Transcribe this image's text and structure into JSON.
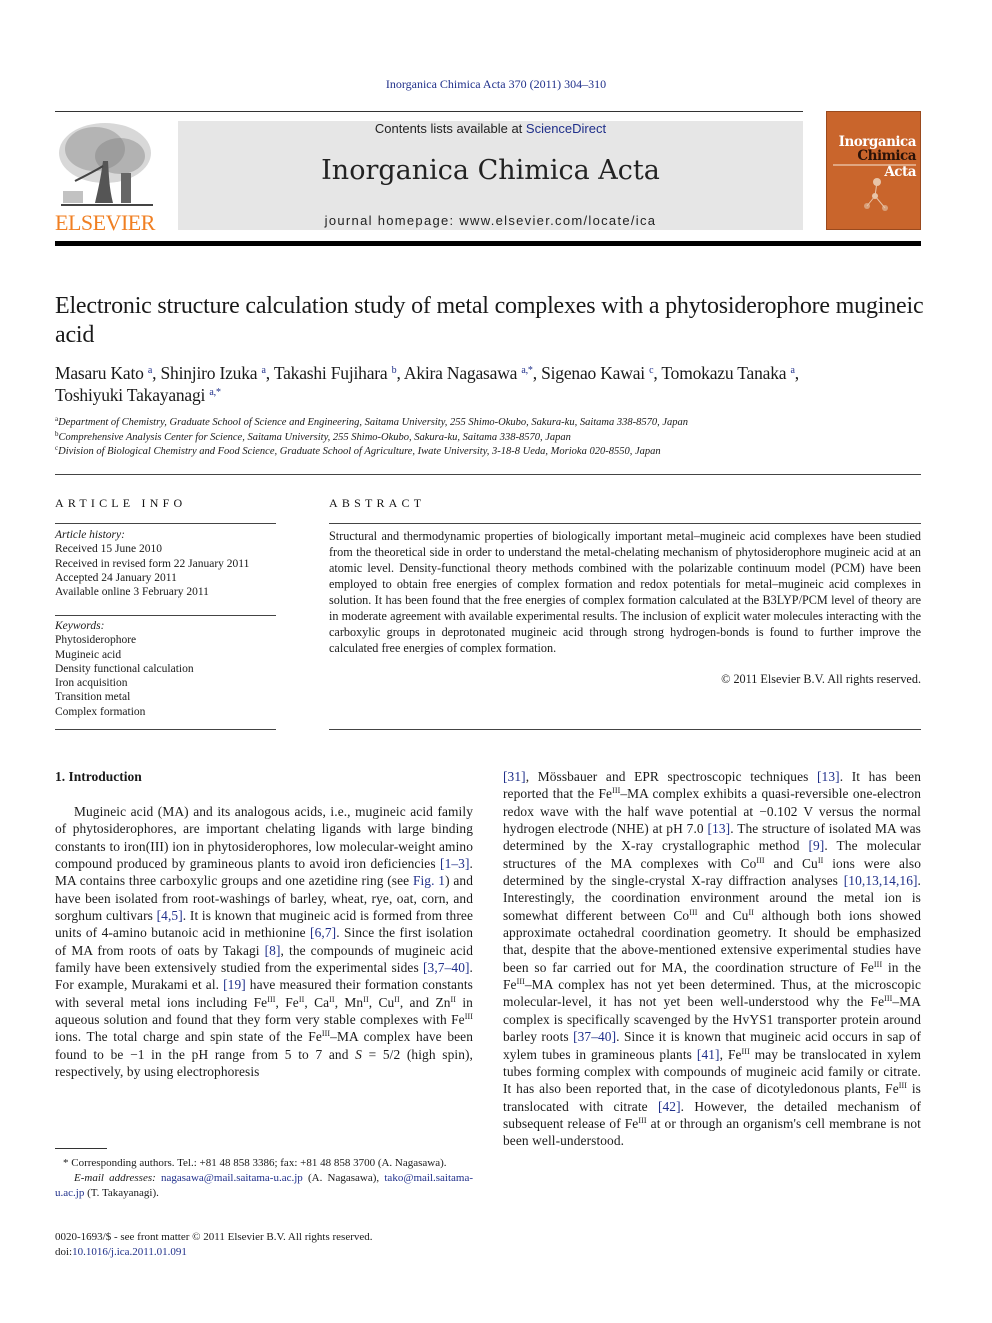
{
  "header": {
    "citation": "Inorganica Chimica Acta 370 (2011) 304–310",
    "contents_prefix": "Contents lists available at ",
    "contents_link": "ScienceDirect",
    "journal_name": "Inorganica Chimica Acta",
    "homepage": "journal homepage: www.elsevier.com/locate/ica",
    "publisher_logo_text": "ELSEVIER",
    "cover": {
      "line1": "Inorganica",
      "line2a": "Chimica",
      "line2b": "Acta",
      "background": "#c9652c"
    }
  },
  "article": {
    "title": "Electronic structure calculation study of metal complexes with a phytosiderophore mugineic acid",
    "authors": [
      {
        "name": "Masaru Kato",
        "aff": "a",
        "sep": ", "
      },
      {
        "name": "Shinjiro Izuka",
        "aff": "a",
        "sep": ", "
      },
      {
        "name": "Takashi Fujihara",
        "aff": "b",
        "sep": ", "
      },
      {
        "name": "Akira Nagasawa",
        "aff": "a,*",
        "sep": ", "
      },
      {
        "name": "Sigenao Kawai",
        "aff": "c",
        "sep": ", "
      },
      {
        "name": "Tomokazu Tanaka",
        "aff": "a",
        "sep": ","
      },
      {
        "name": "Toshiyuki Takayanagi",
        "aff": "a,*",
        "sep": ""
      }
    ],
    "affiliations": [
      {
        "key": "a",
        "text": "Department of Chemistry, Graduate School of Science and Engineering, Saitama University, 255 Shimo-Okubo, Sakura-ku, Saitama 338-8570, Japan"
      },
      {
        "key": "b",
        "text": "Comprehensive Analysis Center for Science, Saitama University, 255 Shimo-Okubo, Sakura-ku, Saitama 338-8570, Japan"
      },
      {
        "key": "c",
        "text": "Division of Biological Chemistry and Food Science, Graduate School of Agriculture, Iwate University, 3-18-8 Ueda, Morioka 020-8550, Japan"
      }
    ]
  },
  "article_info": {
    "heading": "ARTICLE INFO",
    "history_label": "Article history:",
    "history": [
      "Received 15 June 2010",
      "Received in revised form 22 January 2011",
      "Accepted 24 January 2011",
      "Available online 3 February 2011"
    ],
    "keywords_label": "Keywords:",
    "keywords": [
      "Phytosiderophore",
      "Mugineic acid",
      "Density functional calculation",
      "Iron acquisition",
      "Transition metal",
      "Complex formation"
    ]
  },
  "abstract": {
    "heading": "ABSTRACT",
    "text": "Structural and thermodynamic properties of biologically important metal–mugineic acid complexes have been studied from the theoretical side in order to understand the metal-chelating mechanism of phytos­iderophore mugineic acid at an atomic level. Density-functional theory methods combined with the polarizable continuum model (PCM) have been employed to obtain free energies of complex formation and redox potentials for metal–mugineic acid complexes in solution. It has been found that the free ener­gies of complex formation calculated at the B3LYP/PCM level of theory are in moderate agreement with available experimental results. The inclusion of explicit water molecules interacting with the carboxylic groups in deprotonated mugineic acid through strong hydrogen-bonds is found to further improve the calculated free energies of complex formation.",
    "copyright": "© 2011 Elsevier B.V. All rights reserved."
  },
  "intro": {
    "heading": "1. Introduction",
    "left": [
      {
        "t": "Mugineic acid (MA) and its analogous acids, i.e., mugineic acid family of phytosiderophores, are important chelating ligands with large binding constants to iron(III) ion in phytosiderophores, low molecular-weight amino compound produced by gramineous plants to avoid iron deficiencies "
      },
      {
        "link": "[1–3]"
      },
      {
        "t": ". MA contains three carbox­ylic groups and one azetidine ring (see "
      },
      {
        "link": "Fig. 1"
      },
      {
        "t": ") and have been iso­lated from root-washings of barley, wheat, rye, oat, corn, and sorghum cultivars "
      },
      {
        "link": "[4,5]"
      },
      {
        "t": ". It is known that mugineic acid is formed from three units of 4-amino butanoic acid in methionine "
      },
      {
        "link": "[6,7]"
      },
      {
        "t": ". Since the first isolation of MA from roots of oats by Takagi "
      },
      {
        "link": "[8]"
      },
      {
        "t": ", the compounds of mugineic acid family have been extensively studied from the experimental sides "
      },
      {
        "link": "[3,7–40]"
      },
      {
        "t": ". For example, Mura­kami et al. "
      },
      {
        "link": "[19]"
      },
      {
        "t": " have measured their formation constants with several metal ions including Fe"
      },
      {
        "sup": "III"
      },
      {
        "t": ", Fe"
      },
      {
        "sup": "II"
      },
      {
        "t": ", Ca"
      },
      {
        "sup": "II"
      },
      {
        "t": ", Mn"
      },
      {
        "sup": "II"
      },
      {
        "t": ", Cu"
      },
      {
        "sup": "II"
      },
      {
        "t": ", and Zn"
      },
      {
        "sup": "II"
      },
      {
        "t": " in aqueous solution and found that they form very stable complexes with Fe"
      },
      {
        "sup": "III"
      },
      {
        "t": " ions. The total charge and spin state of the Fe"
      },
      {
        "sup": "III"
      },
      {
        "t": "–MA complex have been found to be −1 in the pH range from 5 to 7 and "
      },
      {
        "i": "S"
      },
      {
        "t": " = 5/2 (high spin), respectively, by using electrophoresis"
      }
    ],
    "right": [
      {
        "link": "[31]"
      },
      {
        "t": ", Mössbauer and EPR spectroscopic techniques "
      },
      {
        "link": "[13]"
      },
      {
        "t": ". It has been reported that the Fe"
      },
      {
        "sup": "III"
      },
      {
        "t": "–MA complex exhibits a quasi-revers­ible one-electron redox wave with the half wave potential at −0.102 V versus the normal hydrogen electrode (NHE) at pH 7.0 "
      },
      {
        "link": "[13]"
      },
      {
        "t": ". The structure of isolated MA was determined by the X-ray crystallographic method "
      },
      {
        "link": "[9]"
      },
      {
        "t": ". The molecular structures of the MA complexes with Co"
      },
      {
        "sup": "III"
      },
      {
        "t": " and Cu"
      },
      {
        "sup": "II"
      },
      {
        "t": " ions were also determined by the single-crystal X-ray diffraction analyses "
      },
      {
        "link": "[10,13,14,16]"
      },
      {
        "t": ". Interest­ingly, the coordination environment around the metal ion is somewhat different between Co"
      },
      {
        "sup": "III"
      },
      {
        "t": " and Cu"
      },
      {
        "sup": "II"
      },
      {
        "t": " although both ions showed approximate octahedral coordination geometry. It should be emphasized that, despite that the above-mentioned extensive experimental studies have been so far carried out for MA, the coordination structure of Fe"
      },
      {
        "sup": "III"
      },
      {
        "t": " in the Fe"
      },
      {
        "sup": "III"
      },
      {
        "t": "–MA complex has not yet been determined. Thus, at the microscopic molecular-level, it has not yet been well-understood why the Fe"
      },
      {
        "sup": "III"
      },
      {
        "t": "–MA complex is specifically scavenged by the HvYS1 transporter protein around barley roots "
      },
      {
        "link": "[37–40]"
      },
      {
        "t": ". Since it is known that mugineic acid occurs in sap of xylem tubes in gramineous plants "
      },
      {
        "link": "[41]"
      },
      {
        "t": ", Fe"
      },
      {
        "sup": "III"
      },
      {
        "t": " may be translocated in xylem tubes forming complex with compounds of mugineic acid family or citrate. It has also been reported that, in the case of dicotyledonous plants, Fe"
      },
      {
        "sup": "III"
      },
      {
        "t": " is translocated with cit­rate "
      },
      {
        "link": "[42]"
      },
      {
        "t": ". However, the detailed mechanism of subsequent release of Fe"
      },
      {
        "sup": "III"
      },
      {
        "t": " at or through an organism's cell membrane is not been well-understood."
      }
    ]
  },
  "footnotes": {
    "corresponding": "* Corresponding authors. Tel.: +81 48 858 3386; fax: +81 48 858 3700 (A. Nagasawa).",
    "email_label": "E-mail addresses:",
    "email1": "nagasawa@mail.saitama-u.ac.jp",
    "email1_owner": " (A. Nagasawa), ",
    "email2": "tako@mail.saitama-u.ac.jp",
    "email2_owner": " (T. Takayanagi).",
    "issn": "0020-1693/$ - see front matter © 2011 Elsevier B.V. All rights reserved.",
    "doi_label": "doi:",
    "doi": "10.1016/j.ica.2011.01.091"
  },
  "colors": {
    "link": "#1f2f8a",
    "elsevier_orange": "#f07f22",
    "banner_gray": "#e6e6e6"
  }
}
